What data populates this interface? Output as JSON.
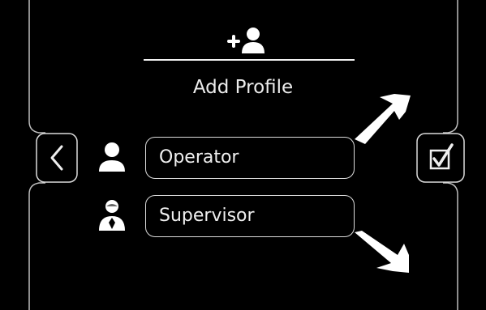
{
  "header": {
    "title": "Add Profile",
    "icon": "add-user-icon"
  },
  "nav": {
    "back_icon": "chevron-left-icon",
    "confirm_icon": "checkbox-checked-icon"
  },
  "profiles": [
    {
      "label": "Operator",
      "icon": "user-icon"
    },
    {
      "label": "Supervisor",
      "icon": "user-tie-icon"
    }
  ],
  "colors": {
    "background": "#000000",
    "foreground": "#ededed",
    "frame": "#bdbdbd"
  }
}
